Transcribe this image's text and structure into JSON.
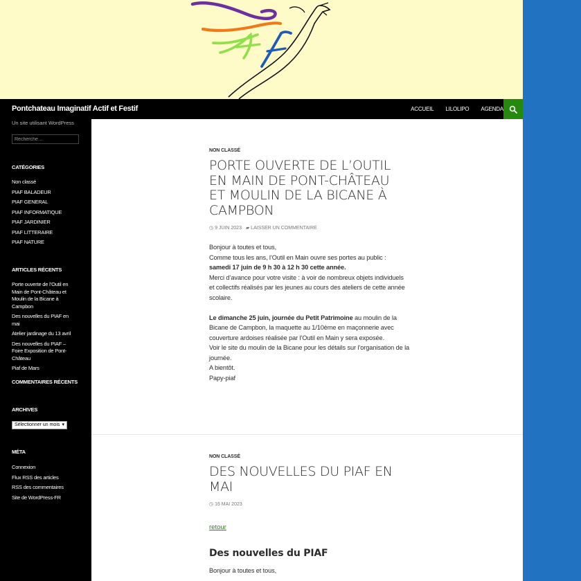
{
  "header": {
    "site_title": "Pontchateau Imaginatif Actif et Festif",
    "tagline": "Un site utilisant WordPress",
    "nav": [
      "Accueil",
      "Lilolipo",
      "Agenda"
    ],
    "search_icon": "search-icon"
  },
  "colors": {
    "accent": "#24890d",
    "banner_bg": "#fffbc8",
    "page_bg": "#2272c2",
    "sidebar_bg": "#000000"
  },
  "sidebar": {
    "search_placeholder": "Recherche…",
    "categories_title": "Catégories",
    "categories": [
      "Non classé",
      "PIAF BALADEUR",
      "PIAF GENERAL",
      "PIAF INFORMATIQUE",
      "PIAF JARDINIER",
      "PIAF LITTERAIRE",
      "PIAF NATURE"
    ],
    "recent_title": "Articles récents",
    "recent": [
      "Porte ouverte de l’Outil en Main de Pont-Château et Moulin de la Bicane à Campbon",
      "Des nouvelles du PIAF en mai",
      "Atelier jardinage du 13 avril",
      "Des nouvelles du PIAF – Foire Exposition de Pont-Château",
      "Piaf de Mars"
    ],
    "comments_title": "Commentaires récents",
    "archives_title": "Archives",
    "archives_select": "Sélectionner un mois",
    "meta_title": "Méta",
    "meta": [
      "Connexion",
      "Flux RSS des articles",
      "RSS des commentaires",
      "Site de WordPress-FR"
    ]
  },
  "post1": {
    "category": "Non classé",
    "title": "Porte ouverte de l’Outil en Main de Pont-Château et Moulin de la Bicane à Campbon",
    "date": "9 juin 2023",
    "comment": "Laisser un commentaire",
    "p1": "Bonjour à toutes et tous,",
    "p2": "Comme tous les ans, l’Outil en Main ouvre ses portes au public :",
    "p3": "samedi 17 juin de 9 h 30 à 12 h 30 cette année.",
    "p4": "Merci d’avance pour votre visite : à voir de nombreux objets individuels et collectifs réalisés par les jeunes au cours des ateliers de cette année scolaire.",
    "p5_bold": "Le dimanche 25 juin, journée du Petit Patrimoine",
    "p5_rest": " au moulin de la Bicane de Campbon, la maquette au 1/10ème en maçonnerie avec couverture ardoises réalisée par l’Outil en Main y sera exposée.",
    "p6": "Voir le site du moulin de la Bicane pour les détails sur l’organisation de la journée.",
    "p7": "A bientôt.",
    "p8": "Papy-piaf"
  },
  "post2": {
    "category": "Non classé",
    "title": "Des nouvelles du PIAF en mai",
    "date": "16 mai 2023",
    "back_link": "retour",
    "subtitle": "Des nouvelles du PIAF",
    "p1": "Bonjour à toutes et tous,"
  }
}
